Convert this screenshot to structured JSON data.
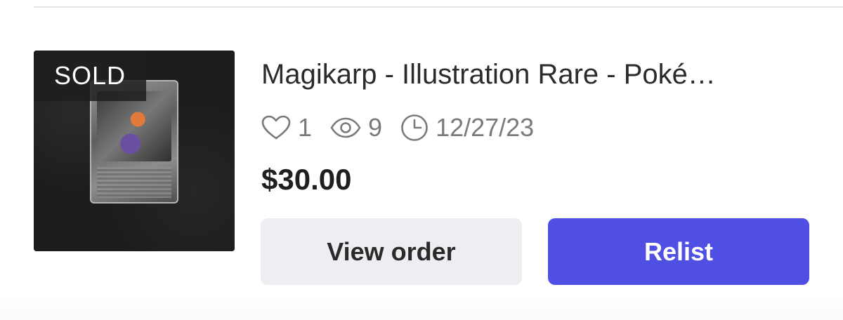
{
  "listing": {
    "badge": "SOLD",
    "title": "Magikarp - Illustration Rare - Poké…",
    "stats": {
      "likes_icon": "heart-icon",
      "likes": "1",
      "views_icon": "eye-icon",
      "views": "9",
      "date_icon": "clock-icon",
      "date": "12/27/23"
    },
    "price": "$30.00",
    "thumbnail": "trading-card-photo"
  },
  "actions": {
    "view_order_label": "View order",
    "relist_label": "Relist"
  },
  "colors": {
    "accent": "#4f4fe3",
    "secondary_button": "#eceef2",
    "icon_gray": "#7a7a7a"
  }
}
